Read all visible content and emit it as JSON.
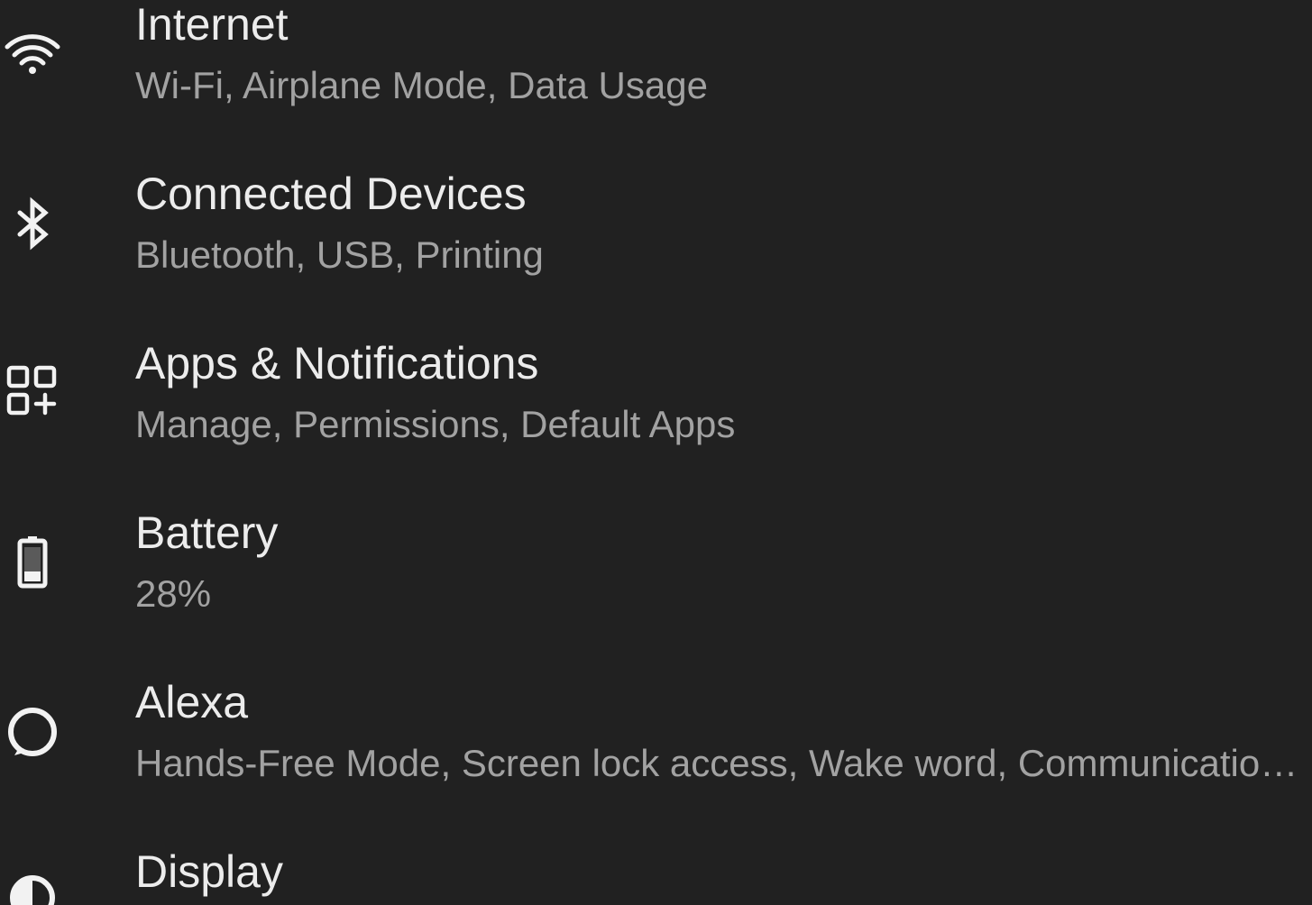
{
  "settings": {
    "items": [
      {
        "id": "internet",
        "icon": "wifi-icon",
        "title": "Internet",
        "summary": "Wi-Fi, Airplane Mode, Data Usage"
      },
      {
        "id": "connected-devices",
        "icon": "bluetooth-icon",
        "title": "Connected Devices",
        "summary": "Bluetooth, USB, Printing"
      },
      {
        "id": "apps-notifications",
        "icon": "apps-icon",
        "title": "Apps & Notifications",
        "summary": "Manage, Permissions, Default Apps"
      },
      {
        "id": "battery",
        "icon": "battery-icon",
        "title": "Battery",
        "summary": "28%"
      },
      {
        "id": "alexa",
        "icon": "alexa-icon",
        "title": "Alexa",
        "summary": "Hands-Free Mode, Screen lock access, Wake word, Communications"
      },
      {
        "id": "display",
        "icon": "display-icon",
        "title": "Display"
      }
    ]
  },
  "colors": {
    "background": "#212121",
    "title": "#ececec",
    "summary": "#a2a2a2",
    "icon": "#f2f2f2"
  }
}
